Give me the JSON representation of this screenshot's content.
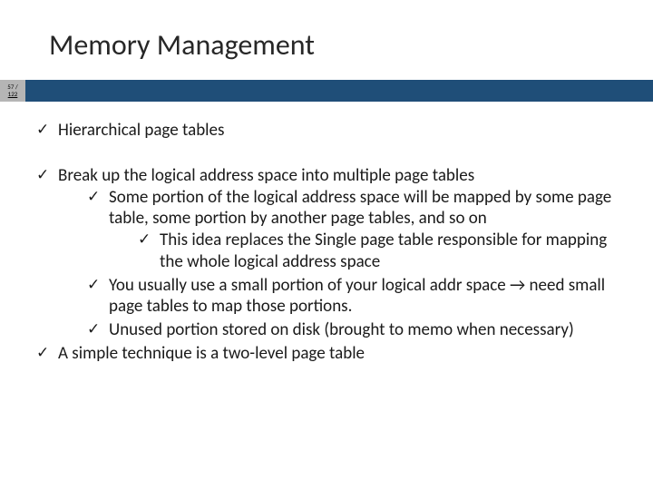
{
  "slide": {
    "title": "Memory Management",
    "page_current": "57 /",
    "page_total": "122"
  },
  "bullets": {
    "b1": "Hierarchical page tables",
    "b2": "Break up the logical address space into multiple page tables",
    "b2_1": "Some portion of the logical address space will be mapped by some page table, some portion by another page tables, and so on",
    "b2_1_1": "This idea replaces the Single page table responsible for mapping the whole logical address space",
    "b2_2": "You usually use a small portion of your logical addr space → need small page tables to map those portions.",
    "b2_3": "Unused portion stored on disk (brought to memo when necessary)",
    "b3": "A simple technique is a two-level page table"
  }
}
